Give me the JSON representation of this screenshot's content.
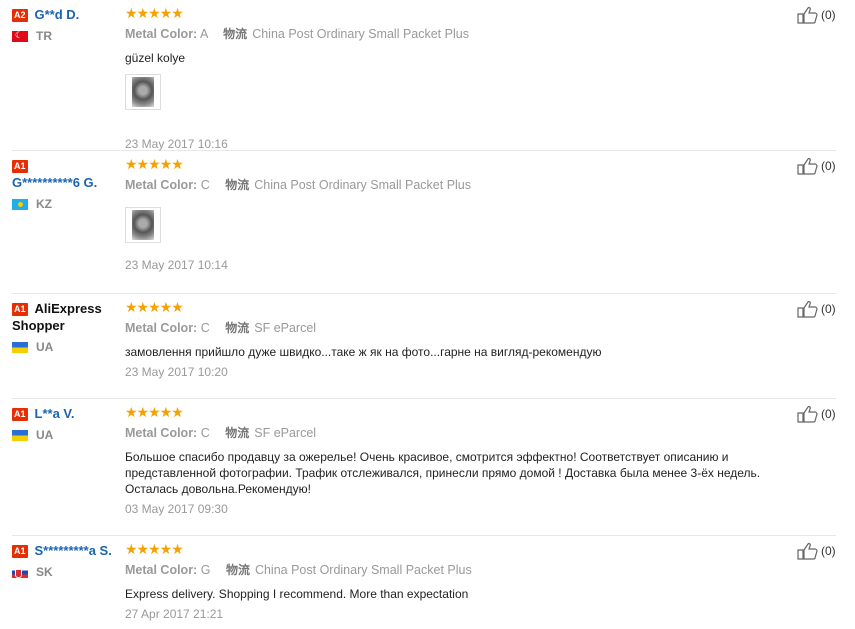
{
  "metal_color_key": "Metal Color:",
  "ship_icon_text": "物流",
  "reviews": [
    {
      "level": "A2",
      "username": "G**d D.",
      "country": "TR",
      "rating": "★★★★★",
      "metal_color": "A",
      "shipping": "China Post Ordinary Small Packet Plus",
      "text": "güzel kolye",
      "date": "23 May 2017 10:16",
      "likes": "(0)"
    },
    {
      "level": "A1",
      "username": "G**********6 G.",
      "country": "KZ",
      "rating": "★★★★★",
      "metal_color": "C",
      "shipping": "China Post Ordinary Small Packet Plus",
      "text": "",
      "date": "23 May 2017 10:14",
      "likes": "(0)"
    },
    {
      "level": "A1",
      "username": "AliExpress Shopper",
      "country": "UA",
      "rating": "★★★★★",
      "metal_color": "C",
      "shipping": "SF eParcel",
      "text": "замовлення прийшло дуже швидко...таке ж як на фото...гарне на вигляд-рекомендую",
      "date": "23 May 2017 10:20",
      "likes": "(0)"
    },
    {
      "level": "A1",
      "username": "L**a V.",
      "country": "UA",
      "rating": "★★★★★",
      "metal_color": "C",
      "shipping": "SF eParcel",
      "text": "Большое спасибо продавцу за ожерелье! Очень красивое, смотрится эффектно! Соответствует описанию и представленной фотографии. Трафик отслеживался, принесли прямо домой ! Доставка была менее 3-ёх недель. Осталась довольна.Рекомендую!",
      "date": "03 May 2017 09:30",
      "likes": "(0)"
    },
    {
      "level": "A1",
      "username": "S*********a S.",
      "country": "SK",
      "rating": "★★★★★",
      "metal_color": "G",
      "shipping": "China Post Ordinary Small Packet Plus",
      "text": "Express delivery. Shopping I recommend. More than expectation",
      "date": "27 Apr 2017 21:21",
      "likes": "(0)"
    }
  ]
}
